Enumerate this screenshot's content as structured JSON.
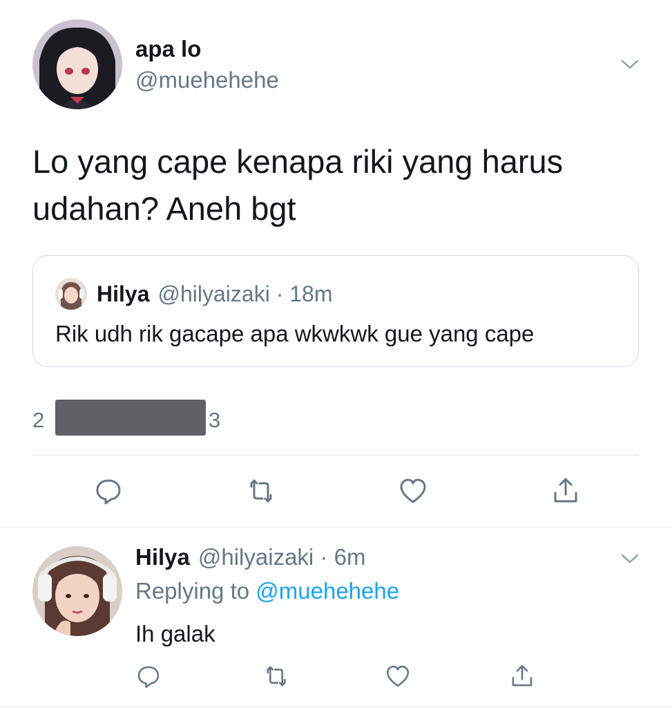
{
  "main_tweet": {
    "display_name": "apa lo",
    "handle": "@muehehehe",
    "text": "Lo yang cape kenapa riki yang harus udahan? Aneh bgt",
    "avatar_icon": "anime-girl-avatar-icon",
    "quote": {
      "display_name": "Hilya",
      "handle_time": "@hilyaizaki · 18m",
      "text": "Rik udh rik gacape apa wkwkwk gue yang cape"
    },
    "stats_left": "2",
    "stats_right": "3",
    "actions": [
      "reply-icon",
      "retweet-icon",
      "like-icon",
      "share-icon"
    ]
  },
  "reply_tweet": {
    "display_name": "Hilya",
    "handle_time": "@hilyaizaki · 6m",
    "replying_prefix": "Replying to ",
    "replying_to": "@muehehehe",
    "text": "Ih galak",
    "actions": [
      "reply-icon",
      "retweet-icon",
      "like-icon",
      "share-icon"
    ]
  },
  "colors": {
    "text": "#14171a",
    "secondary": "#657786",
    "link": "#1da1f2",
    "border": "#e1e8ed"
  }
}
